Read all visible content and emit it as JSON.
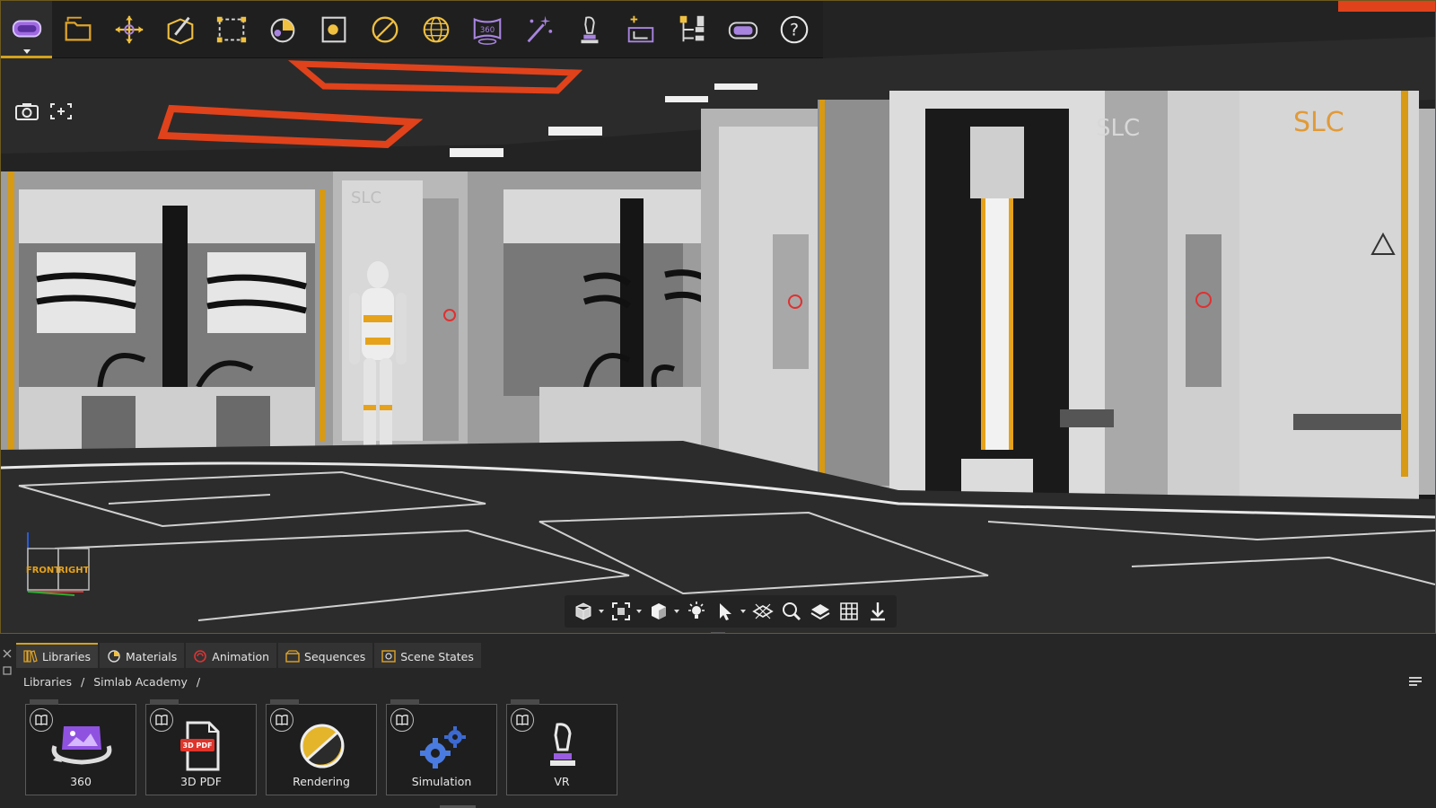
{
  "toolbar": {
    "buttons": [
      {
        "name": "vr-headset-icon",
        "active": true
      },
      {
        "name": "open-folder-icon"
      },
      {
        "name": "transform-move-icon"
      },
      {
        "name": "edit-object-icon"
      },
      {
        "name": "selection-box-icon"
      },
      {
        "name": "materials-icon"
      },
      {
        "name": "render-frame-icon"
      },
      {
        "name": "rendering-icon"
      },
      {
        "name": "environment-globe-icon"
      },
      {
        "name": "panorama-360-icon",
        "label": "360"
      },
      {
        "name": "magic-wand-icon"
      },
      {
        "name": "vr-controller-icon"
      },
      {
        "name": "scene-tree-icon"
      },
      {
        "name": "hierarchy-icon"
      },
      {
        "name": "vr-view-icon"
      },
      {
        "name": "help-icon",
        "label": "?"
      }
    ]
  },
  "scene": {
    "wall_logo": "SLC"
  },
  "view_cube": {
    "front_label": "FRONT",
    "right_label": "RIGHT"
  },
  "panel": {
    "tabs": [
      {
        "label": "Libraries",
        "active": true,
        "icon": "libraries-icon"
      },
      {
        "label": "Materials",
        "icon": "materials-tab-icon"
      },
      {
        "label": "Animation",
        "icon": "animation-icon"
      },
      {
        "label": "Sequences",
        "icon": "sequences-icon"
      },
      {
        "label": "Scene States",
        "icon": "scene-states-icon"
      }
    ],
    "breadcrumb": [
      "Libraries",
      "/",
      "Simlab Academy",
      "/"
    ],
    "cards": [
      {
        "label": "360",
        "icon": "panorama-360-card-icon"
      },
      {
        "label": "3D PDF",
        "icon": "pdf-card-icon",
        "badge": "3D PDF"
      },
      {
        "label": "Rendering",
        "icon": "rendering-card-icon"
      },
      {
        "label": "Simulation",
        "icon": "simulation-card-icon"
      },
      {
        "label": "VR",
        "icon": "vr-card-icon"
      }
    ]
  },
  "colors": {
    "accent": "#d3a21c",
    "toolbar_icon": "#a884e0",
    "panel_bg": "#262626"
  }
}
